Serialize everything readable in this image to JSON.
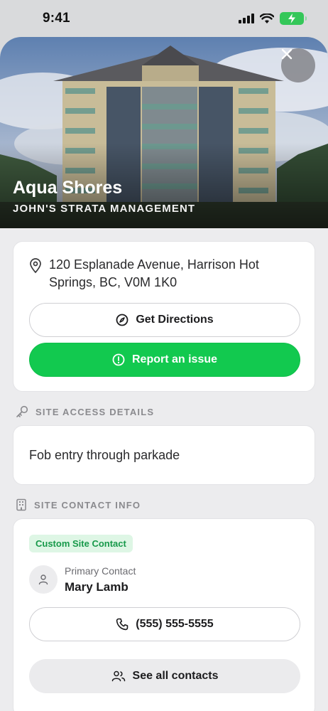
{
  "status_bar": {
    "time": "9:41"
  },
  "hero": {
    "title": "Aqua Shores",
    "subtitle": "JOHN'S STRATA MANAGEMENT"
  },
  "address": {
    "text": "120 Esplanade Avenue, Harrison Hot Springs, BC, V0M 1K0",
    "directions_label": "Get Directions",
    "report_label": "Report an issue"
  },
  "site_access": {
    "heading": "SITE ACCESS DETAILS",
    "details": "Fob entry through parkade"
  },
  "site_contact": {
    "heading": "SITE CONTACT INFO",
    "tag": "Custom Site Contact",
    "role": "Primary Contact",
    "name": "Mary Lamb",
    "phone": "(555) 555-5555",
    "see_all_label": "See all contacts"
  },
  "colors": {
    "accent_green": "#12c94f",
    "tag_bg": "#def6e5",
    "tag_text": "#17994a"
  },
  "icons": [
    "signal-icon",
    "wifi-icon",
    "battery-charging-icon",
    "close-icon",
    "map-pin-icon",
    "compass-icon",
    "alert-circle-icon",
    "key-icon",
    "building-icon",
    "user-icon",
    "phone-icon",
    "users-icon"
  ]
}
